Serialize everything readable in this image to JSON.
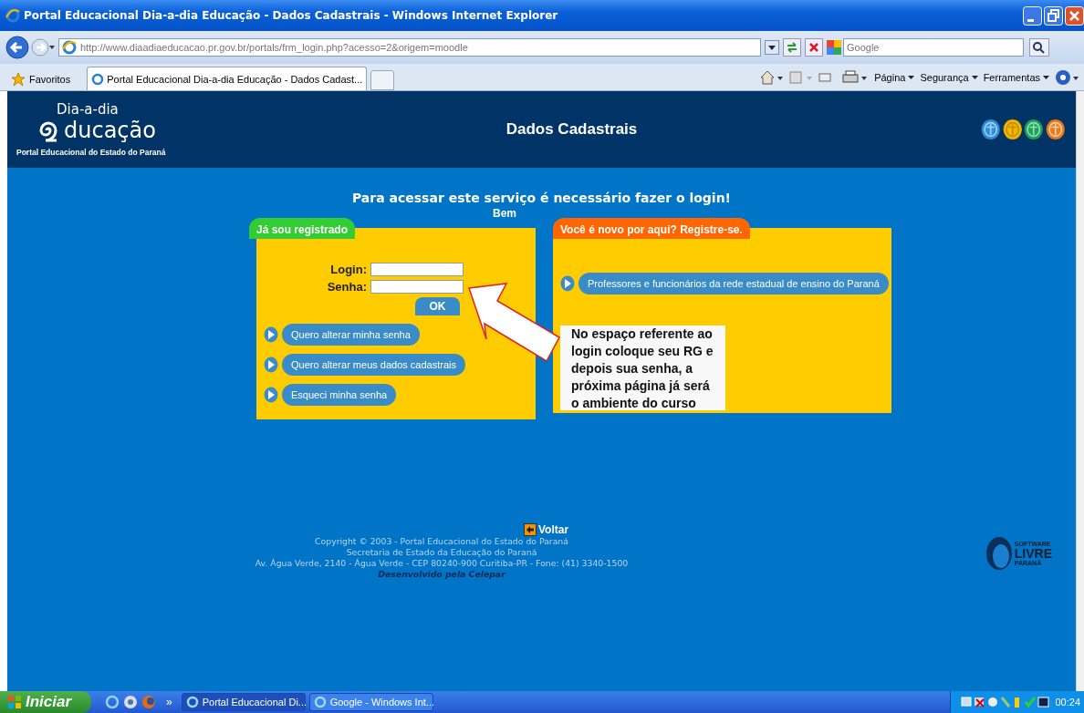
{
  "browser": {
    "title": "Portal Educacional Dia-a-dia Educação - Dados Cadastrais - Windows Internet Explorer",
    "address": "http://www.diaadiaeducacao.pr.gov.br/portals/frm_login.php?acesso=2&origem=moodle",
    "search_placeholder": "Google",
    "favorites": "Favoritos",
    "tabs": [
      {
        "label": "Portal Educacional Dia-a-dia Educação - Dados Cadast...",
        "selected": true
      }
    ],
    "commands": [
      "Página",
      "Segurança",
      "Ferramentas"
    ]
  },
  "header": {
    "logo_top": "Dia-a-dia",
    "logo_main": "ducação",
    "logo_sub": "Portal Educacional do Estado do Paraná",
    "title": "Dados Cadastrais"
  },
  "notice": "Para acessar este serviço é necessário fazer o login!",
  "partial_heading": "Bem",
  "login_panel": {
    "tab": "Já sou registrado",
    "fields": [
      "Login:",
      "Senha:"
    ],
    "submit": "OK",
    "links": [
      "Quero alterar minha senha",
      "Quero alterar meus dados cadastrais",
      "Esqueci minha senha"
    ]
  },
  "register_panel": {
    "tab": "Você é novo por aqui? Registre-se.",
    "links": [
      "Professores e funcionários da rede estadual de ensino do Paraná"
    ]
  },
  "callout": "No espaço referente ao login coloque seu RG e depois sua senha, a próxima página já será o ambiente do curso",
  "footer": {
    "back": "Voltar",
    "lines": [
      "Copyright © 2003 - Portal Educacional do Estado do Paraná",
      "Secretaria de Estado da Educação do Paraná",
      "Av. Água Verde, 2140 - Água Verde - CEP 80240-900 Curitiba-PR - Fone: (41) 3340-1500"
    ],
    "credit": "Desenvolvido pela Celepar",
    "badge": [
      "SOFTWARE",
      "LIVRE",
      "PARANÁ"
    ]
  },
  "taskbar": {
    "start": "Iniciar",
    "more": "»",
    "windows": [
      {
        "label": "Portal Educacional Di...",
        "selected": true
      },
      {
        "label": "Google - Windows Int...",
        "selected": false
      }
    ],
    "clock": "00:24"
  }
}
